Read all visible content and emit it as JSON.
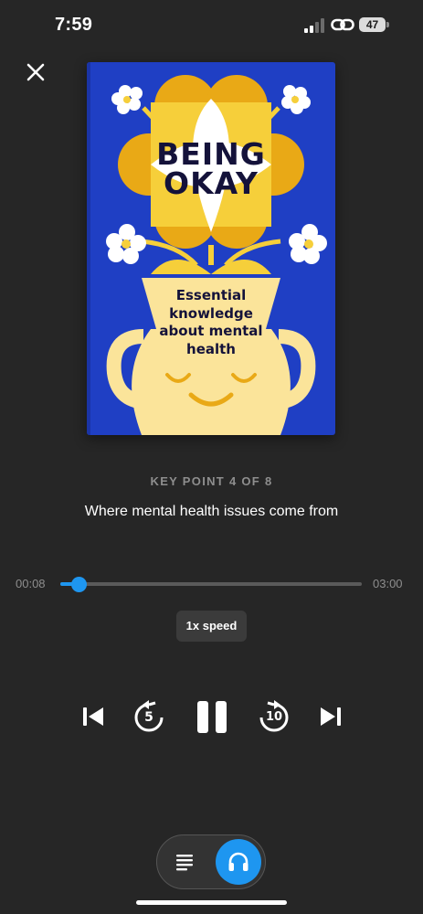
{
  "status_bar": {
    "time": "7:59",
    "battery": "47"
  },
  "book": {
    "title_line1": "BEING",
    "title_line2": "OKAY",
    "subtitle": "Essential knowledge about mental health"
  },
  "key_point": {
    "label": "KEY POINT 4 OF 8",
    "title": "Where mental health issues come from"
  },
  "player": {
    "elapsed": "00:08",
    "total": "03:00",
    "progress_fraction": 0.063,
    "speed_label": "1x speed",
    "rewind_seconds": "5",
    "forward_seconds": "10"
  },
  "colors": {
    "accent": "#1e96f0",
    "background": "#262626",
    "cover_blue": "#1f3fc4",
    "cover_yellow": "#f6cf3a"
  },
  "icons": {
    "close": "close-icon",
    "previous": "skip-previous-icon",
    "rewind": "rewind-5-icon",
    "pause": "pause-icon",
    "forward": "forward-10-icon",
    "next": "skip-next-icon",
    "text_mode": "text-lines-icon",
    "audio_mode": "headphones-icon"
  }
}
